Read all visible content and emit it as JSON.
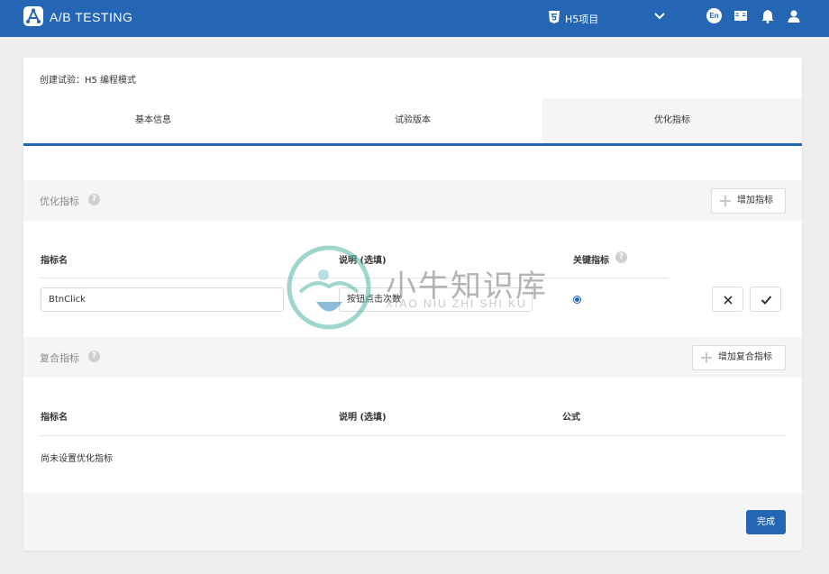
{
  "brand": {
    "name": "A/B TESTING"
  },
  "header": {
    "project": "H5项目",
    "language": "En",
    "icons": [
      "html5-icon",
      "chevron-down-icon",
      "language-icon",
      "book-icon",
      "bell-icon",
      "user-icon"
    ]
  },
  "page": {
    "title": "创建试验：H5 编程模式"
  },
  "tabs": [
    {
      "label": "基本信息",
      "active": false
    },
    {
      "label": "试验版本",
      "active": false
    },
    {
      "label": "优化指标",
      "active": true
    }
  ],
  "optimization": {
    "title": "优化指标",
    "add_button": "增加指标",
    "columns": {
      "name": "指标名",
      "desc": "说明 (选填)",
      "key": "关键指标"
    },
    "row": {
      "name": "BtnClick",
      "desc": "按钮点击次数",
      "is_key": true
    }
  },
  "composite": {
    "title": "复合指标",
    "add_button": "增加复合指标",
    "columns": {
      "name": "指标名",
      "desc": "说明 (选填)",
      "formula": "公式"
    },
    "empty_text": "尚未设置优化指标"
  },
  "footer": {
    "done_button": "完成"
  },
  "watermark": {
    "title": "小牛知识库",
    "subtitle": "XIAO NIU ZHI SHI KU"
  },
  "colors": {
    "primary": "#2466b4",
    "background": "#eeeeee",
    "section": "#f5f5f5"
  }
}
